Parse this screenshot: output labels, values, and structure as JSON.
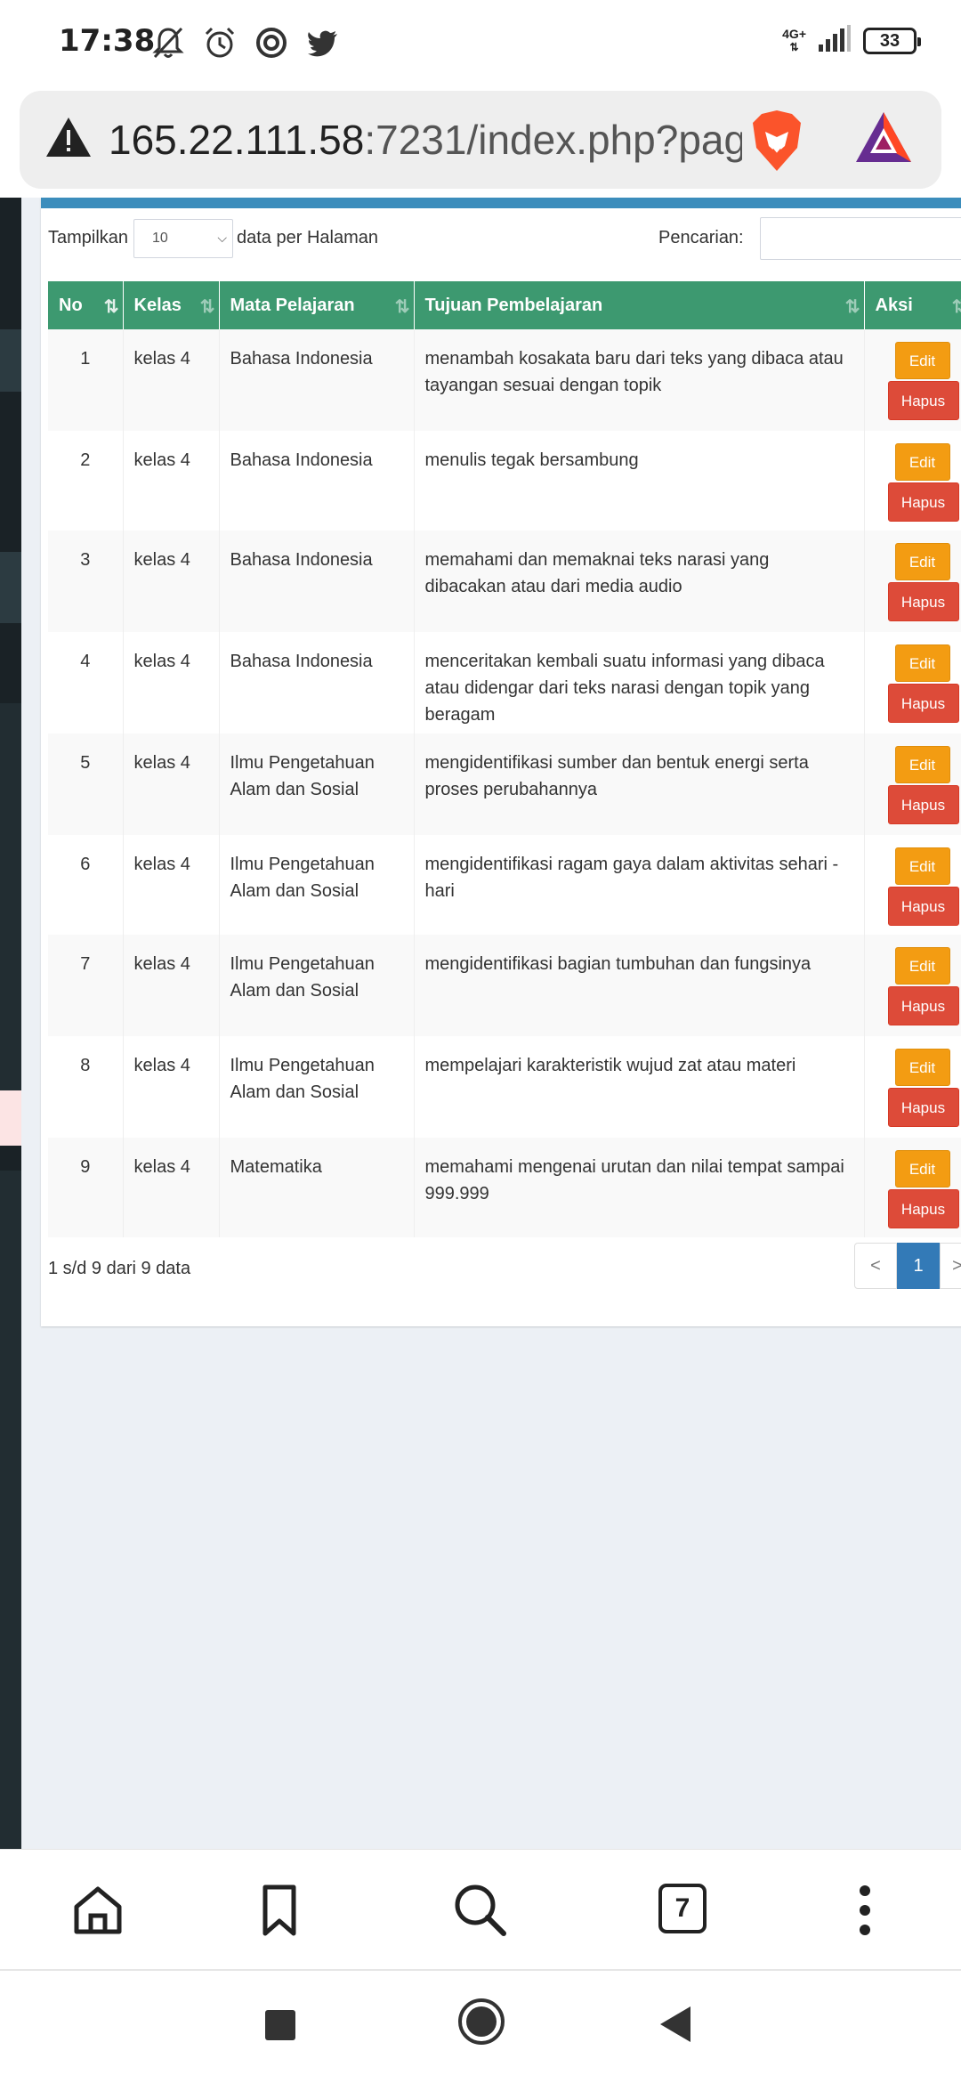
{
  "status_bar": {
    "time": "17:38",
    "network": "4G+",
    "battery": "33",
    "icons": [
      "bell-off-icon",
      "alarm-icon",
      "sync-icon",
      "twitter-icon",
      "signal-icon"
    ]
  },
  "url_bar": {
    "host": "165.22.111.58",
    "rest": ":7231/index.php?pag",
    "icons": [
      "warning-icon",
      "brave-lion-icon",
      "bat-rewards-icon"
    ]
  },
  "controls": {
    "show_label": "Tampilkan",
    "page_size": "10",
    "per_page_label": "data per Halaman",
    "search_label": "Pencarian:",
    "search_value": ""
  },
  "table": {
    "headers": [
      "No",
      "Kelas",
      "Mata Pelajaran",
      "Tujuan Pembelajaran",
      "Aksi"
    ],
    "rows": [
      {
        "no": "1",
        "kelas": "kelas 4",
        "mapel": "Bahasa Indonesia",
        "tujuan": "menambah kosakata baru dari teks yang dibaca atau tayangan sesuai dengan topik"
      },
      {
        "no": "2",
        "kelas": "kelas 4",
        "mapel": "Bahasa Indonesia",
        "tujuan": "menulis tegak bersambung"
      },
      {
        "no": "3",
        "kelas": "kelas 4",
        "mapel": "Bahasa Indonesia",
        "tujuan": "memahami dan memaknai teks narasi yang dibacakan atau dari media audio"
      },
      {
        "no": "4",
        "kelas": "kelas 4",
        "mapel": "Bahasa Indonesia",
        "tujuan": "menceritakan kembali suatu informasi yang dibaca atau didengar dari teks narasi dengan topik yang beragam"
      },
      {
        "no": "5",
        "kelas": "kelas 4",
        "mapel": "Ilmu Pengetahuan Alam dan Sosial",
        "tujuan": "mengidentifikasi sumber dan bentuk energi serta proses perubahannya"
      },
      {
        "no": "6",
        "kelas": "kelas 4",
        "mapel": "Ilmu Pengetahuan Alam dan Sosial",
        "tujuan": "mengidentifikasi ragam gaya dalam aktivitas sehari - hari"
      },
      {
        "no": "7",
        "kelas": "kelas 4",
        "mapel": "Ilmu Pengetahuan Alam dan Sosial",
        "tujuan": "mengidentifikasi bagian tumbuhan dan fungsinya"
      },
      {
        "no": "8",
        "kelas": "kelas 4",
        "mapel": "Ilmu Pengetahuan Alam dan Sosial",
        "tujuan": "mempelajari karakteristik wujud zat atau materi"
      },
      {
        "no": "9",
        "kelas": "kelas 4",
        "mapel": "Matematika",
        "tujuan": "memahami mengenai urutan dan nilai tempat sampai 999.999"
      }
    ],
    "edit_label": "Edit",
    "delete_label": "Hapus"
  },
  "footer": {
    "info": "1 s/d 9 dari 9 data",
    "prev": "<",
    "current_page": "1",
    "next": ">"
  },
  "browser_toolbar": {
    "tab_count": "7",
    "icons": [
      "home-icon",
      "bookmark-icon",
      "search-icon",
      "tabs-icon",
      "more-icon"
    ]
  },
  "nav_bar": {
    "icons": [
      "recents-icon",
      "home-circle-icon",
      "back-icon"
    ]
  },
  "colors": {
    "table_header": "#3d9970",
    "edit_button": "#f39c12",
    "delete_button": "#dd4b39",
    "pagination_active": "#337ab7",
    "card_border": "#3c8dbc"
  }
}
